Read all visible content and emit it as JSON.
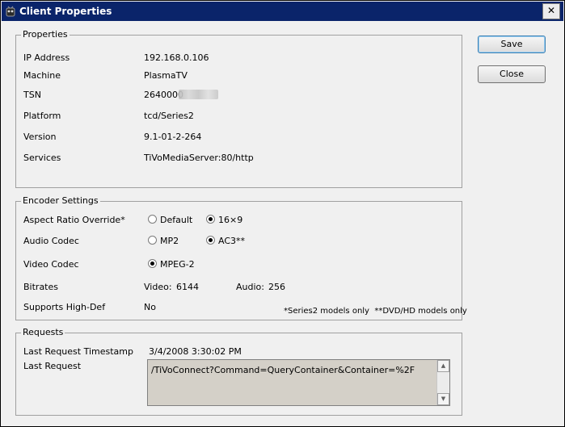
{
  "window": {
    "title": "Client Properties",
    "close_label": "✕"
  },
  "buttons": {
    "save": "Save",
    "close": "Close"
  },
  "properties": {
    "legend": "Properties",
    "ip_label": "IP Address",
    "ip_value": "192.168.0.106",
    "machine_label": "Machine",
    "machine_value": "PlasmaTV",
    "tsn_label": "TSN",
    "tsn_value": "2640000",
    "platform_label": "Platform",
    "platform_value": "tcd/Series2",
    "version_label": "Version",
    "version_value": "9.1-01-2-264",
    "services_label": "Services",
    "services_value": "TiVoMediaServer:80/http"
  },
  "encoder": {
    "legend": "Encoder Settings",
    "aspect_label": "Aspect Ratio Override*",
    "aspect_default": "Default",
    "aspect_169": "16×9",
    "aspect_selected": "16×9",
    "audio_label": "Audio Codec",
    "audio_mp2": "MP2",
    "audio_ac3": "AC3**",
    "audio_selected": "AC3**",
    "video_label": "Video Codec",
    "video_mpeg2": "MPEG-2",
    "video_selected": "MPEG-2",
    "bitrates_label": "Bitrates",
    "video_rate_label": "Video:",
    "video_rate_value": "6144",
    "audio_rate_label": "Audio:",
    "audio_rate_value": "256",
    "hd_label": "Supports High-Def",
    "hd_value": "No",
    "footnote": "*Series2 models only  **DVD/HD models only"
  },
  "requests": {
    "legend": "Requests",
    "timestamp_label": "Last Request Timestamp",
    "timestamp_value": "3/4/2008 3:30:02 PM",
    "last_label": "Last Request",
    "last_value": "/TiVoConnect?Command=QueryContainer&Container=%2F"
  },
  "icons": {
    "window_icon": "tivo-guy-icon",
    "up": "▲",
    "down": "▼"
  },
  "colors": {
    "titlebar": "#0a246a"
  }
}
